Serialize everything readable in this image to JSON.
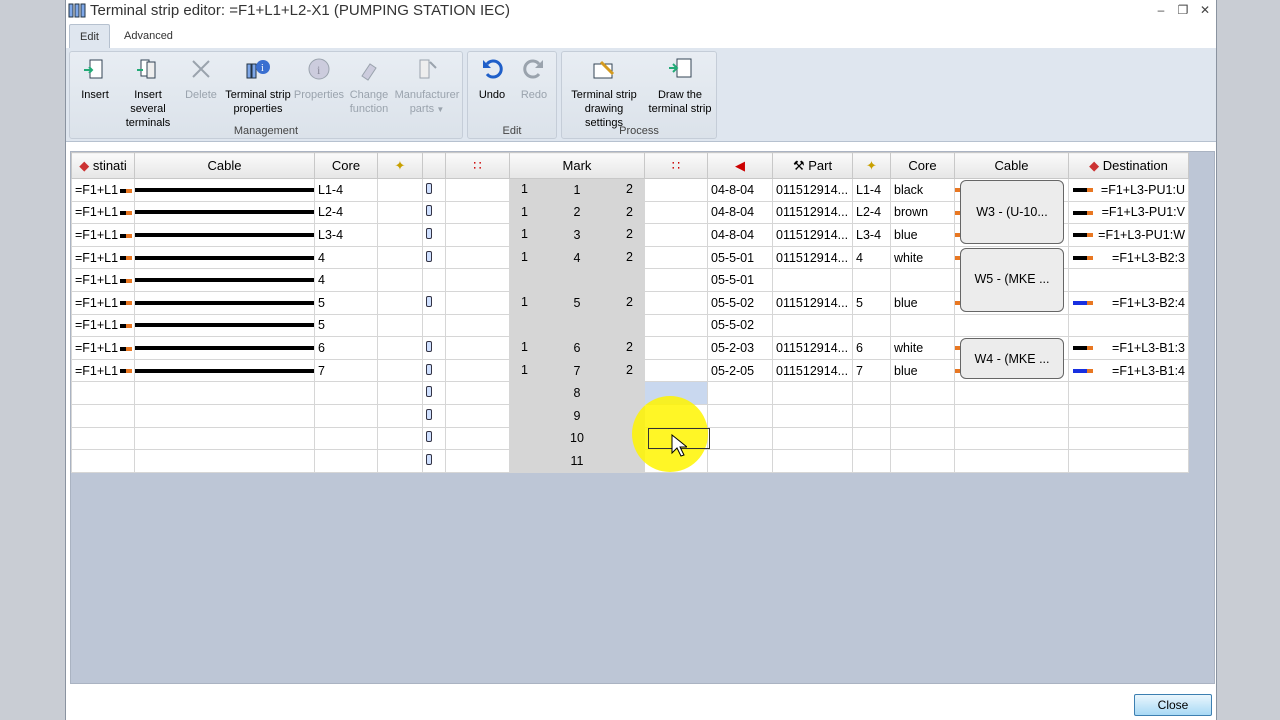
{
  "window": {
    "title": "Terminal strip editor: =F1+L1+L2-X1 (PUMPING STATION IEC)"
  },
  "tabs": [
    {
      "label": "Edit"
    },
    {
      "label": "Advanced"
    }
  ],
  "ribbon": {
    "management": {
      "label": "Management",
      "buttons": [
        {
          "label": "Insert",
          "icon": "insert-terminal-icon"
        },
        {
          "label": "Insert several terminals",
          "icon": "insert-several-icon"
        },
        {
          "label": "Delete",
          "icon": "delete-icon"
        },
        {
          "label": "Terminal strip properties",
          "icon": "strip-properties-icon"
        },
        {
          "label": "Properties",
          "icon": "info-icon"
        },
        {
          "label": "Change function",
          "icon": "change-function-icon"
        },
        {
          "label": "Manufacturer parts",
          "icon": "manufacturer-parts-icon"
        }
      ]
    },
    "edit": {
      "label": "Edit",
      "buttons": [
        {
          "label": "Undo",
          "icon": "undo-icon"
        },
        {
          "label": "Redo",
          "icon": "redo-icon"
        }
      ]
    },
    "process": {
      "label": "Process",
      "buttons": [
        {
          "label": "Terminal strip drawing settings",
          "icon": "drawing-settings-icon"
        },
        {
          "label": "Draw the terminal strip",
          "icon": "draw-strip-icon"
        }
      ]
    }
  },
  "grid": {
    "headers": [
      "stinati",
      "Cable",
      "Core",
      "",
      "",
      "",
      "Mark",
      "",
      "",
      "Part",
      "",
      "Core",
      "Cable",
      "Destination"
    ],
    "rows": [
      {
        "dest_left": "=F1+L1",
        "core_left": "L1-4",
        "mark": "1",
        "mark_l": "1",
        "mark_r": "2",
        "terminal": "04-8-04",
        "part": "011512914...",
        "core_num": "L1-4",
        "core": "black",
        "dest": "=F1+L3-PU1:U"
      },
      {
        "dest_left": "=F1+L1",
        "core_left": "L2-4",
        "mark": "2",
        "mark_l": "1",
        "mark_r": "2",
        "terminal": "04-8-04",
        "part": "011512914...",
        "core_num": "L2-4",
        "core": "brown",
        "dest": "=F1+L3-PU1:V"
      },
      {
        "dest_left": "=F1+L1",
        "core_left": "L3-4",
        "mark": "3",
        "mark_l": "1",
        "mark_r": "2",
        "terminal": "04-8-04",
        "part": "011512914...",
        "core_num": "L3-4",
        "core": "blue",
        "dest": "=F1+L3-PU1:W"
      },
      {
        "dest_left": "=F1+L1",
        "core_left": "4",
        "mark": "4",
        "mark_l": "1",
        "mark_r": "2",
        "terminal": "05-5-01",
        "part": "011512914...",
        "core_num": "4",
        "core": "white",
        "dest": "=F1+L3-B2:3"
      },
      {
        "dest_left": "=F1+L1",
        "core_left": "4",
        "terminal": "05-5-01"
      },
      {
        "dest_left": "=F1+L1",
        "core_left": "5",
        "mark": "5",
        "mark_l": "1",
        "mark_r": "2",
        "terminal": "05-5-02",
        "part": "011512914...",
        "core_num": "5",
        "core": "blue",
        "dest": "=F1+L3-B2:4"
      },
      {
        "dest_left": "=F1+L1",
        "core_left": "5",
        "terminal": "05-5-02"
      },
      {
        "dest_left": "=F1+L1",
        "core_left": "6",
        "mark": "6",
        "mark_l": "1",
        "mark_r": "2",
        "terminal": "05-2-03",
        "part": "011512914...",
        "core_num": "6",
        "core": "white",
        "dest": "=F1+L3-B1:3"
      },
      {
        "dest_left": "=F1+L1",
        "core_left": "7",
        "mark": "7",
        "mark_l": "1",
        "mark_r": "2",
        "terminal": "05-2-05",
        "part": "011512914...",
        "core_num": "7",
        "core": "blue",
        "dest": "=F1+L3-B1:4"
      },
      {
        "mark": "8"
      },
      {
        "mark": "9"
      },
      {
        "mark": "10"
      },
      {
        "mark": "11"
      }
    ],
    "cables": [
      "W3 - (U-10...",
      "W5 - (MKE ...",
      "W4 - (MKE ..."
    ]
  },
  "footer": {
    "close_label": "Close"
  },
  "colors": {
    "accent": "#dfe6ef",
    "wire_black": "#000000",
    "wire_blue": "#1830e0",
    "wire_end": "#e87722"
  }
}
